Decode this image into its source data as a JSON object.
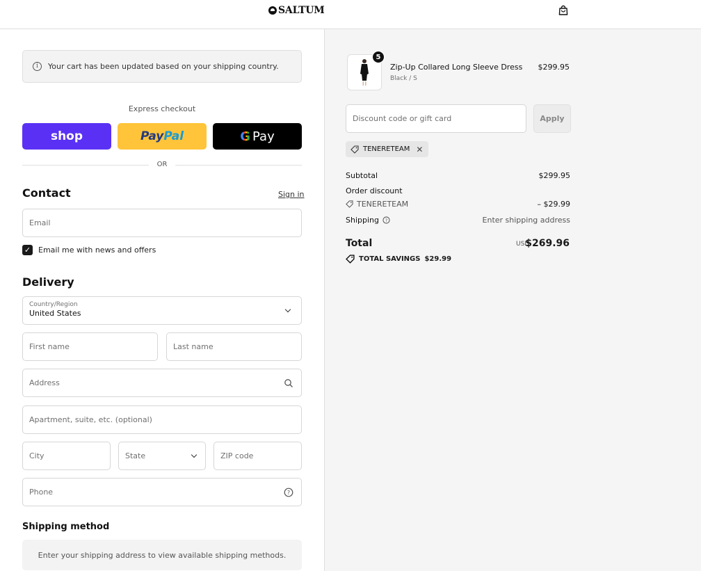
{
  "header": {
    "brand": "SALTUM"
  },
  "notice": {
    "text": "Your cart has been updated based on your shipping country."
  },
  "express": {
    "label": "Express checkout",
    "shop": "shop",
    "paypal_a": "Pay",
    "paypal_b": "Pal",
    "gpay_g": "G",
    "gpay_text": "Pay",
    "or": "OR"
  },
  "contact": {
    "title": "Contact",
    "sign_in": "Sign in",
    "email_placeholder": "Email",
    "newsletter_label": "Email me with news and offers",
    "newsletter_checked": true
  },
  "delivery": {
    "title": "Delivery",
    "country_label": "Country/Region",
    "country_value": "United States",
    "first_name": "First name",
    "last_name": "Last name",
    "address": "Address",
    "apartment": "Apartment, suite, etc. (optional)",
    "city": "City",
    "state": "State",
    "zip": "ZIP code",
    "phone": "Phone"
  },
  "shipping_method": {
    "title": "Shipping method",
    "message": "Enter your shipping address to view available shipping methods."
  },
  "order": {
    "item": {
      "name": "Zip-Up Collared Long Sleeve Dress",
      "variant": "Black / S",
      "price": "$299.95",
      "quantity": "5"
    },
    "discount_placeholder": "Discount code or gift card",
    "apply": "Apply",
    "code_chip": "TENERETEAM",
    "subtotal_label": "Subtotal",
    "subtotal_value": "$299.95",
    "order_discount_label": "Order discount",
    "discount_code": "TENERETEAM",
    "discount_value": "– $29.99",
    "shipping_label": "Shipping",
    "shipping_value": "Enter shipping address",
    "total_label": "Total",
    "currency": "USD",
    "total_value": "$269.96",
    "savings_label": "TOTAL SAVINGS",
    "savings_value": "$29.99"
  },
  "watermark": "Tenereteam",
  "colors": {
    "shop": "#5a31f4",
    "paypal": "#ffc439",
    "gpay": "#000000",
    "sidebar": "#f5f5f5"
  }
}
